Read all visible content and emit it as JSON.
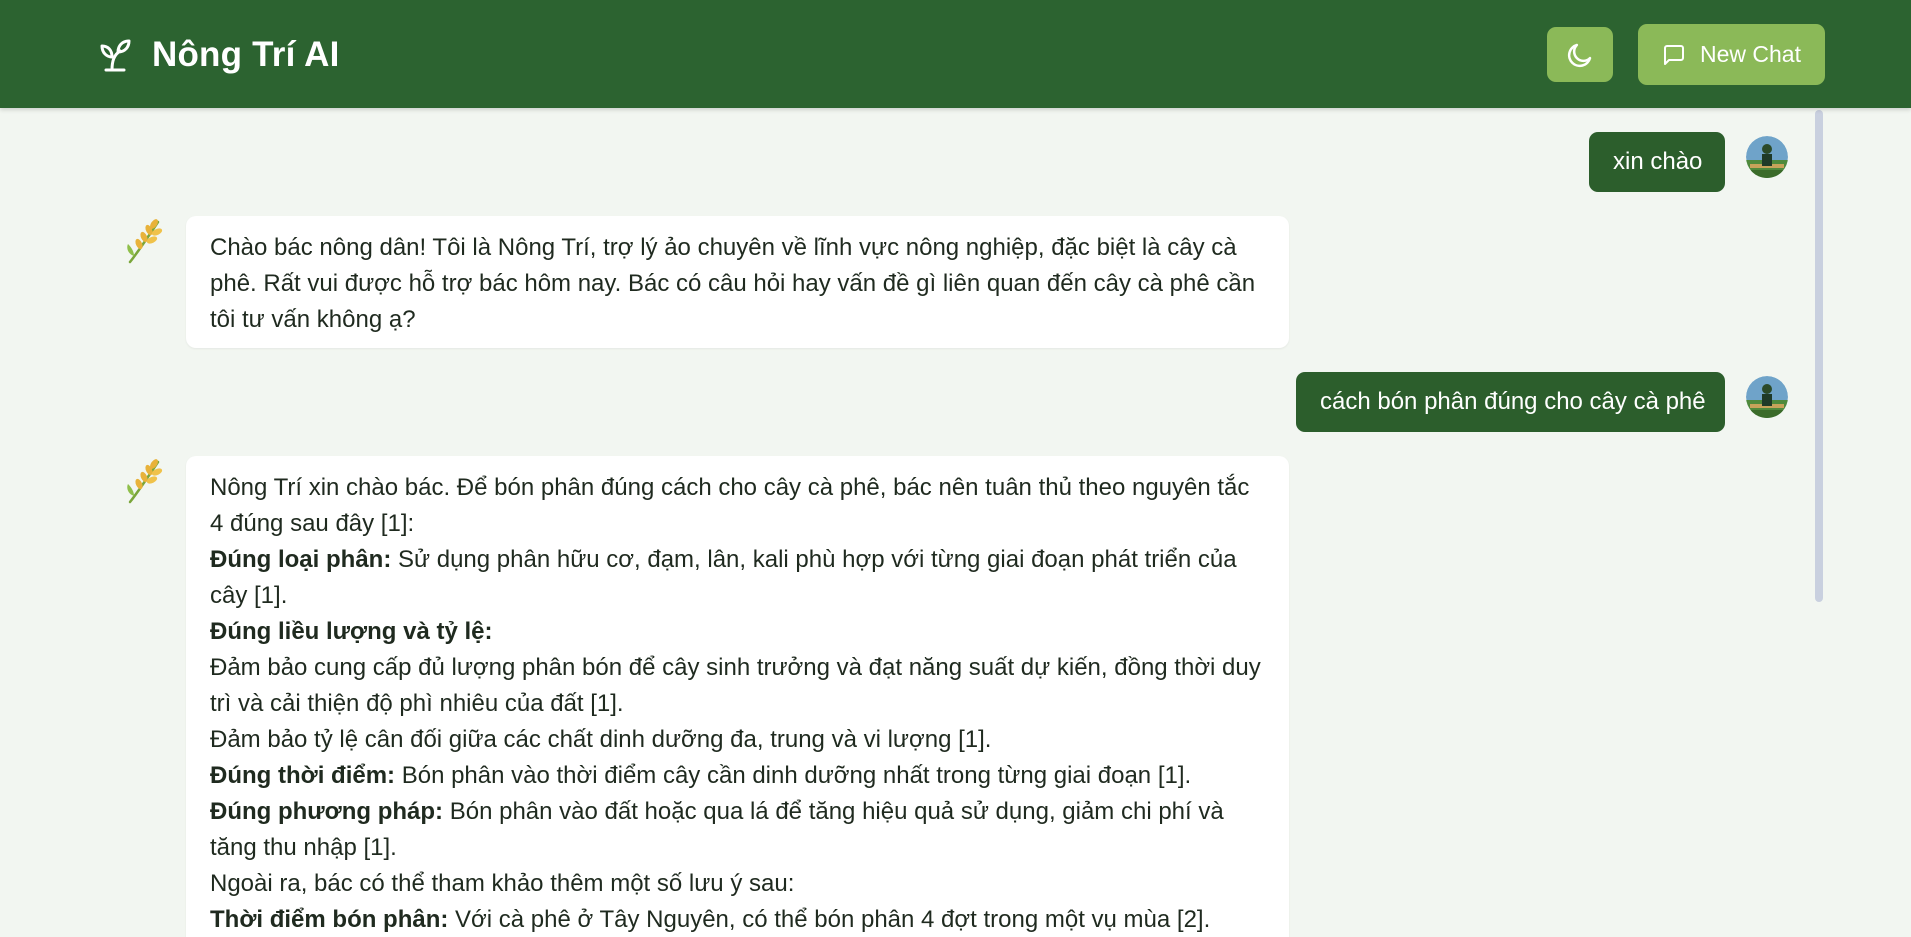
{
  "header": {
    "title": "Nông Trí AI",
    "new_chat_label": "New Chat",
    "theme_icon": "moon-icon",
    "brand_icon": "sprout-icon",
    "colors": {
      "header_bg": "#2c6330",
      "button_bg": "#8bb958",
      "user_bubble": "#2c5e2c"
    }
  },
  "messages": {
    "m1": {
      "role": "user",
      "text": "xin chào"
    },
    "m2": {
      "role": "assistant",
      "text": "Chào bác nông dân! Tôi là Nông Trí, trợ lý ảo chuyên về lĩnh vực nông nghiệp, đặc biệt là cây cà phê. Rất vui được hỗ trợ bác hôm nay. Bác có câu hỏi hay vấn đề gì liên quan đến cây cà phê cần tôi tư vấn không ạ?"
    },
    "m3": {
      "role": "user",
      "text": "cách bón phân đúng cho cây cà phê"
    },
    "m4": {
      "role": "assistant",
      "intro": "Nông Trí xin chào bác. Để bón phân đúng cách cho cây cà phê, bác nên tuân thủ theo nguyên tắc 4 đúng sau đây [1]:",
      "p1_bold": "Đúng loại phân:",
      "p1_text": " Sử dụng phân hữu cơ, đạm, lân, kali phù hợp với từng giai đoạn phát triển của cây [1].",
      "p2_bold": "Đúng liều lượng và tỷ lệ:",
      "p2_line1": "Đảm bảo cung cấp đủ lượng phân bón để cây sinh trưởng và đạt năng suất dự kiến, đồng thời duy trì và cải thiện độ phì nhiêu của đất [1].",
      "p2_line2": "Đảm bảo tỷ lệ cân đối giữa các chất dinh dưỡng đa, trung và vi lượng [1].",
      "p3_bold": "Đúng thời điểm:",
      "p3_text": " Bón phân vào thời điểm cây cần dinh dưỡng nhất trong từng giai đoạn [1].",
      "p4_bold": "Đúng phương pháp:",
      "p4_text": " Bón phân vào đất hoặc qua lá để tăng hiệu quả sử dụng, giảm chi phí và tăng thu nhập [1].",
      "extra_intro": "Ngoài ra, bác có thể tham khảo thêm một số lưu ý sau:",
      "p5_bold": "Thời điểm bón phân:",
      "p5_text": " Với cà phê ở Tây Nguyên, có thể bón phân 4 đợt trong một vụ mùa [2]."
    }
  }
}
